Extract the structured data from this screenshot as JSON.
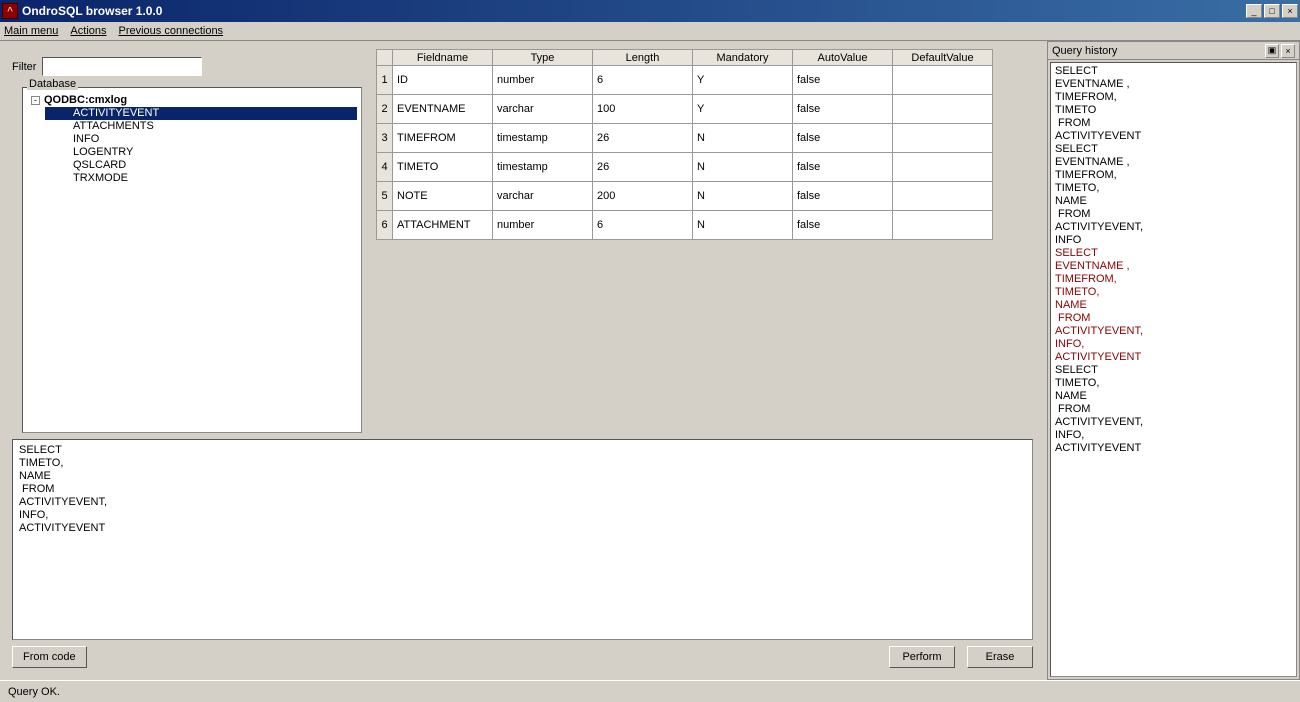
{
  "window": {
    "title": "OndroSQL browser 1.0.0"
  },
  "menu": {
    "main": "Main menu",
    "actions": "Actions",
    "prev": "Previous connections"
  },
  "filter": {
    "label": "Filter",
    "value": ""
  },
  "db_panel": {
    "label": "Database"
  },
  "tree": {
    "root": "QODBC:cmxlog",
    "items": [
      "ACTIVITYEVENT",
      "ATTACHMENTS",
      "INFO",
      "LOGENTRY",
      "QSLCARD",
      "TRXMODE"
    ],
    "selected": "ACTIVITYEVENT"
  },
  "grid": {
    "headers": [
      "Fieldname",
      "Type",
      "Length",
      "Mandatory",
      "AutoValue",
      "DefaultValue"
    ],
    "rows": [
      {
        "n": "1",
        "field": "ID",
        "type": "number",
        "len": "6",
        "mand": "Y",
        "auto": "false",
        "def": ""
      },
      {
        "n": "2",
        "field": "EVENTNAME",
        "type": "varchar",
        "len": "100",
        "mand": "Y",
        "auto": "false",
        "def": ""
      },
      {
        "n": "3",
        "field": "TIMEFROM",
        "type": "timestamp",
        "len": "26",
        "mand": "N",
        "auto": "false",
        "def": ""
      },
      {
        "n": "4",
        "field": "TIMETO",
        "type": "timestamp",
        "len": "26",
        "mand": "N",
        "auto": "false",
        "def": ""
      },
      {
        "n": "5",
        "field": "NOTE",
        "type": "varchar",
        "len": "200",
        "mand": "N",
        "auto": "false",
        "def": ""
      },
      {
        "n": "6",
        "field": "ATTACHMENT",
        "type": "number",
        "len": "6",
        "mand": "N",
        "auto": "false",
        "def": ""
      }
    ]
  },
  "sql": {
    "text": "SELECT\nTIMETO,\nNAME\n FROM\nACTIVITYEVENT,\nINFO,\nACTIVITYEVENT"
  },
  "buttons": {
    "from_code": "From code",
    "perform": "Perform",
    "erase": "Erase"
  },
  "status": {
    "text": "Query OK."
  },
  "history": {
    "title": "Query history",
    "entries": [
      {
        "text": "SELECT\nEVENTNAME ,\nTIMEFROM,\nTIMETO\n FROM\nACTIVITYEVENT",
        "error": false
      },
      {
        "text": "SELECT\nEVENTNAME ,\nTIMEFROM,\nTIMETO,\nNAME\n FROM\nACTIVITYEVENT,\nINFO",
        "error": false
      },
      {
        "text": "SELECT\nEVENTNAME ,\nTIMEFROM,\nTIMETO,\nNAME\n FROM\nACTIVITYEVENT,\nINFO,\nACTIVITYEVENT",
        "error": true
      },
      {
        "text": "SELECT\nTIMETO,\nNAME\n FROM\nACTIVITYEVENT,\nINFO,\nACTIVITYEVENT",
        "error": false
      }
    ]
  }
}
